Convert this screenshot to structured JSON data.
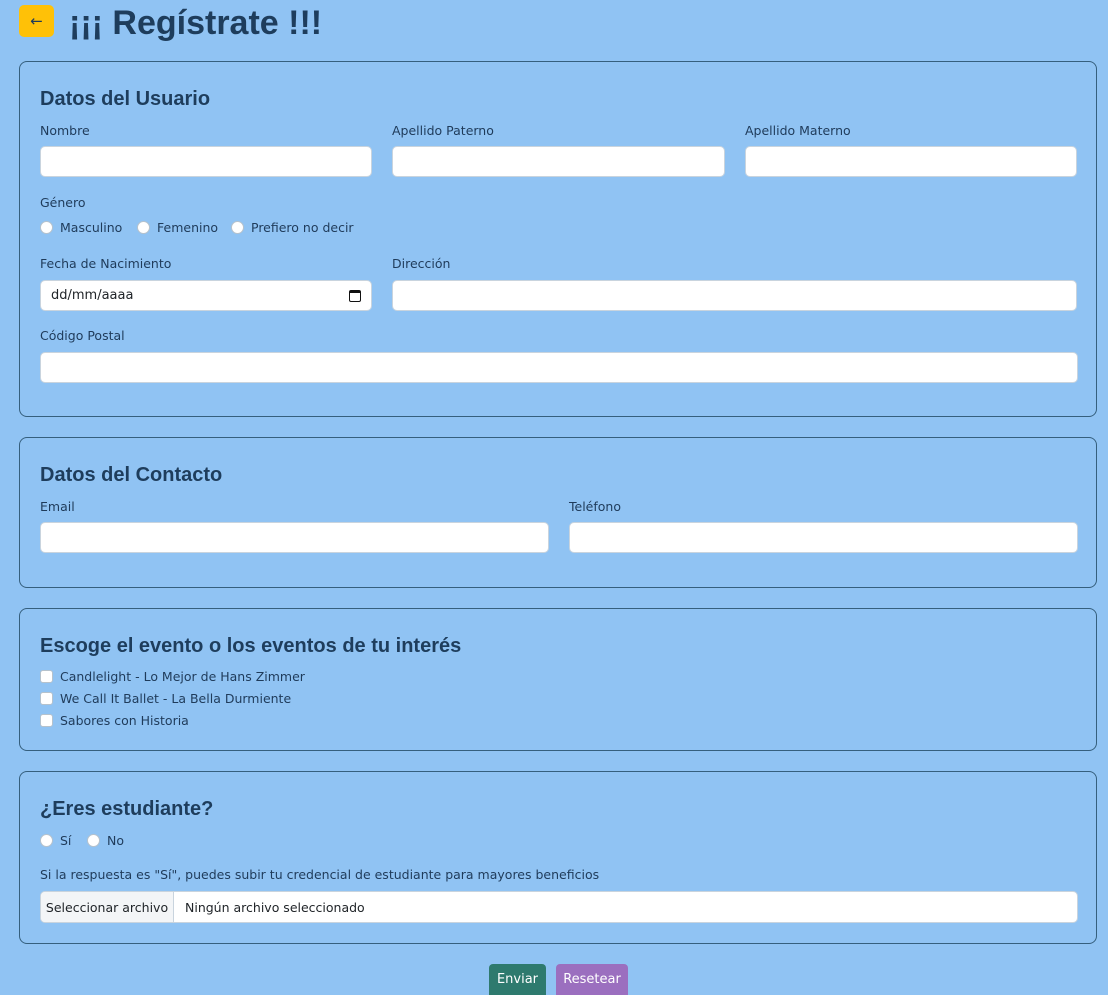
{
  "header": {
    "back_icon": "←",
    "title": "¡¡¡ Regístrate !!!"
  },
  "user": {
    "title": "Datos del Usuario",
    "nombre_label": "Nombre",
    "paterno_label": "Apellido Paterno",
    "materno_label": "Apellido Materno",
    "genero_label": "Género",
    "genero_options": [
      "Masculino",
      "Femenino",
      "Prefiero no decir"
    ],
    "fecha_label": "Fecha de Nacimiento",
    "fecha_placeholder": "dd/mm/aaaa",
    "direccion_label": "Dirección",
    "cp_label": "Código Postal"
  },
  "contact": {
    "title": "Datos del Contacto",
    "email_label": "Email",
    "telefono_label": "Teléfono"
  },
  "events": {
    "title": "Escoge el evento o los eventos de tu interés",
    "items": [
      "Candlelight - Lo Mejor de Hans Zimmer",
      "We Call It Ballet - La Bella Durmiente",
      "Sabores con Historia"
    ]
  },
  "student": {
    "title": "¿Eres estudiante?",
    "options": [
      "Sí",
      "No"
    ],
    "note": "Si la respuesta es \"Sí\", puedes subir tu credencial de estudiante para mayores beneficios",
    "file_button": "Seleccionar archivo",
    "file_status": "Ningún archivo seleccionado"
  },
  "actions": {
    "submit": "Enviar",
    "reset": "Resetear"
  },
  "colors": {
    "background": "#90c3f3",
    "back_button": "#ffc107",
    "submit": "#2e7a6e",
    "reset": "#9b6fbf"
  }
}
